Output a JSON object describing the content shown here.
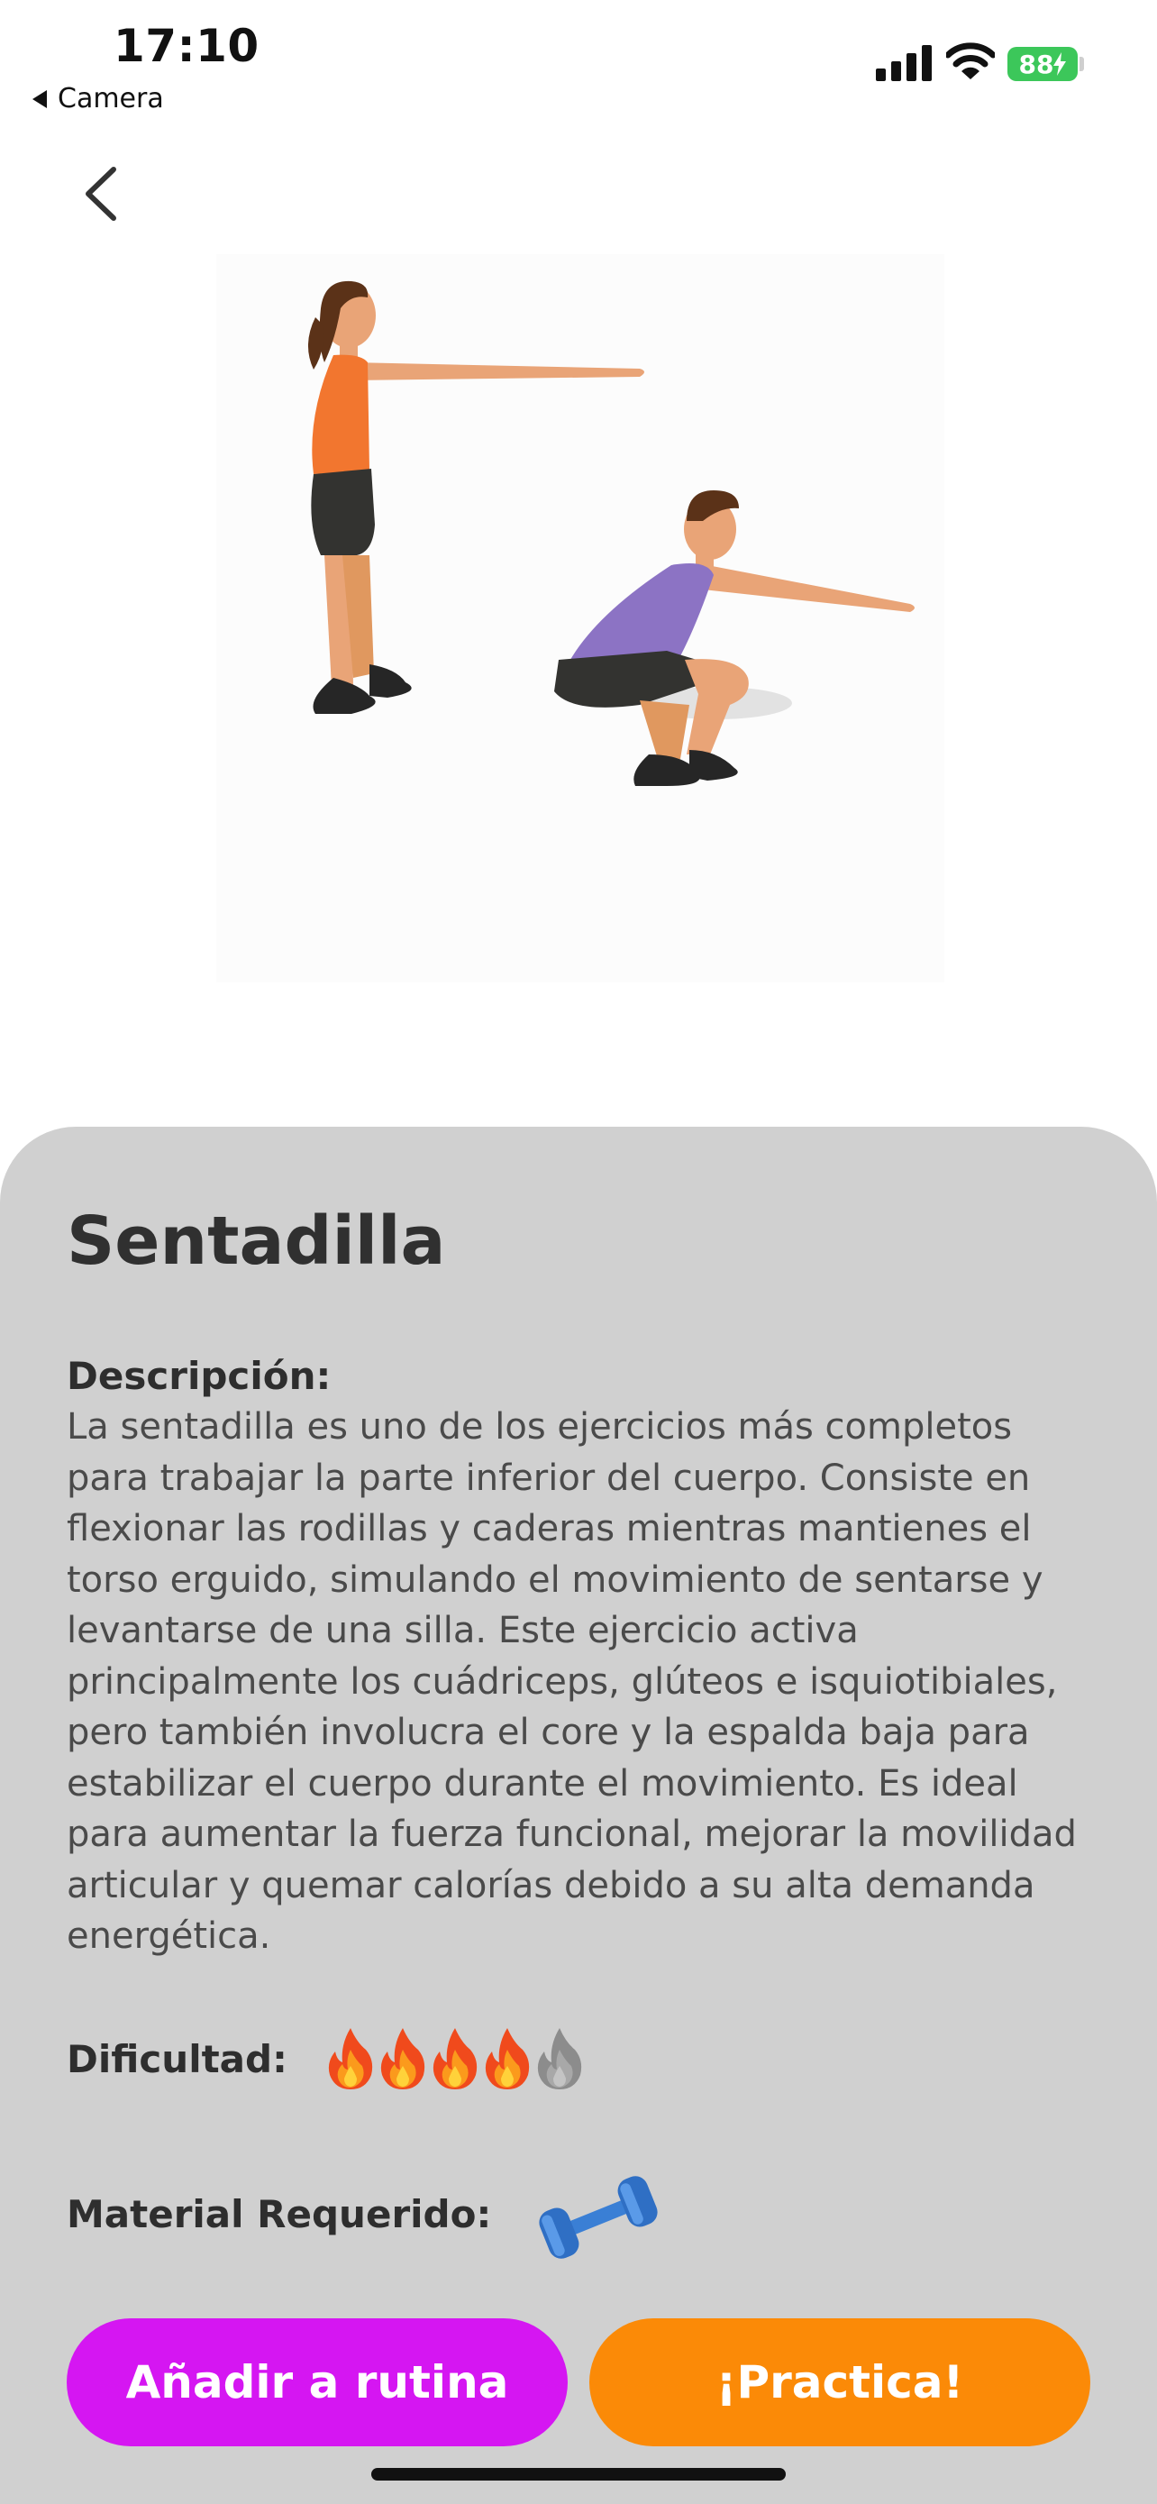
{
  "status_bar": {
    "time": "17:10",
    "back_app_label": "Camera",
    "battery_level": "88"
  },
  "exercise": {
    "title": "Sentadilla",
    "description_label": "Descripción:",
    "description": "La sentadilla es uno de los ejercicios más completos para trabajar la parte inferior del cuerpo. Consiste en flexionar las rodillas y caderas mientras mantienes el torso erguido, simulando el movimiento de sentarse y levantarse de una silla. Este ejercicio activa principalmente los cuádriceps, glúteos e isquiotibiales, pero también involucra el core y la espalda baja para estabilizar el cuerpo durante el movimiento. Es ideal para aumentar la fuerza funcional, mejorar la movilidad articular y quemar calorías debido a su alta demanda energética.",
    "difficulty_label": "Dificultad:",
    "difficulty": {
      "level": 4,
      "max": 5
    },
    "material_label": "Material Requerido:",
    "material_icon": "dumbbell-icon"
  },
  "actions": {
    "add_label": "Añadir a rutina",
    "practice_label": "¡Practica!"
  },
  "colors": {
    "sheet_bg": "#d0d0d0",
    "add_button": "#d516f2",
    "practice_button": "#fb8a07",
    "battery": "#3cc75a"
  }
}
